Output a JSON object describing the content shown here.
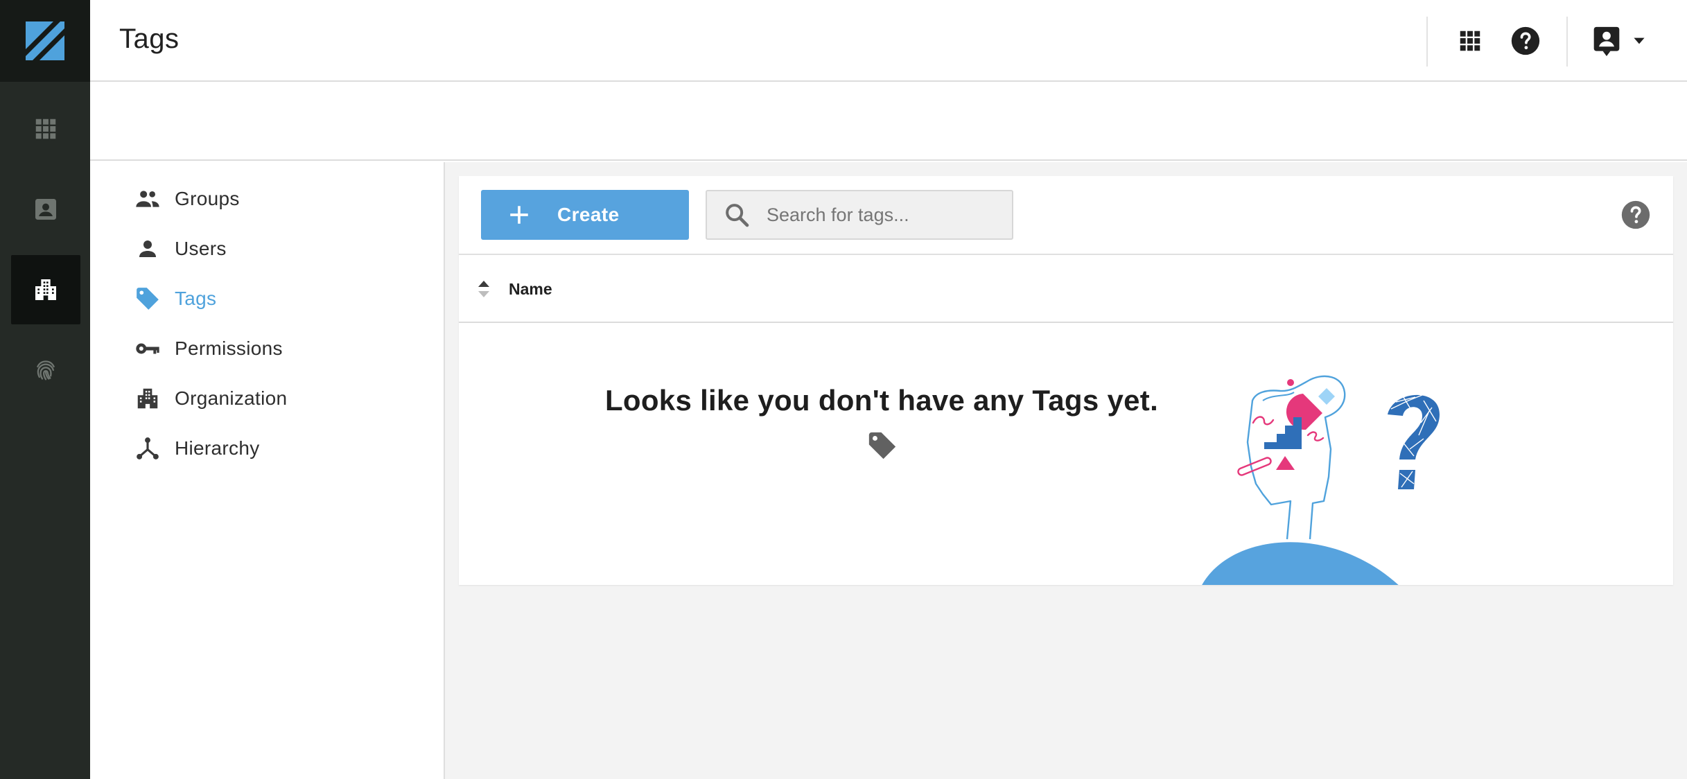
{
  "header": {
    "title": "Tags"
  },
  "rail": {
    "items": [
      "apps-icon",
      "contact-card-icon",
      "organization-icon",
      "fingerprint-icon"
    ],
    "active": "organization-icon"
  },
  "sidebar": {
    "items": [
      {
        "label": "Groups",
        "icon": "groups-icon"
      },
      {
        "label": "Users",
        "icon": "user-icon"
      },
      {
        "label": "Tags",
        "icon": "tag-icon",
        "active": true
      },
      {
        "label": "Permissions",
        "icon": "key-icon"
      },
      {
        "label": "Organization",
        "icon": "building-icon"
      },
      {
        "label": "Hierarchy",
        "icon": "hierarchy-icon"
      }
    ]
  },
  "toolbar": {
    "create_label": "Create",
    "search_placeholder": "Search for tags..."
  },
  "table": {
    "columns": [
      "Name"
    ]
  },
  "empty_state": {
    "message": "Looks like you don't have any Tags yet."
  },
  "colors": {
    "accent": "#57a3de",
    "active_nav": "#4fa2dc",
    "rail": "#252a26",
    "illustration_pink": "#e5387b",
    "illustration_blue": "#2f6fb8"
  }
}
